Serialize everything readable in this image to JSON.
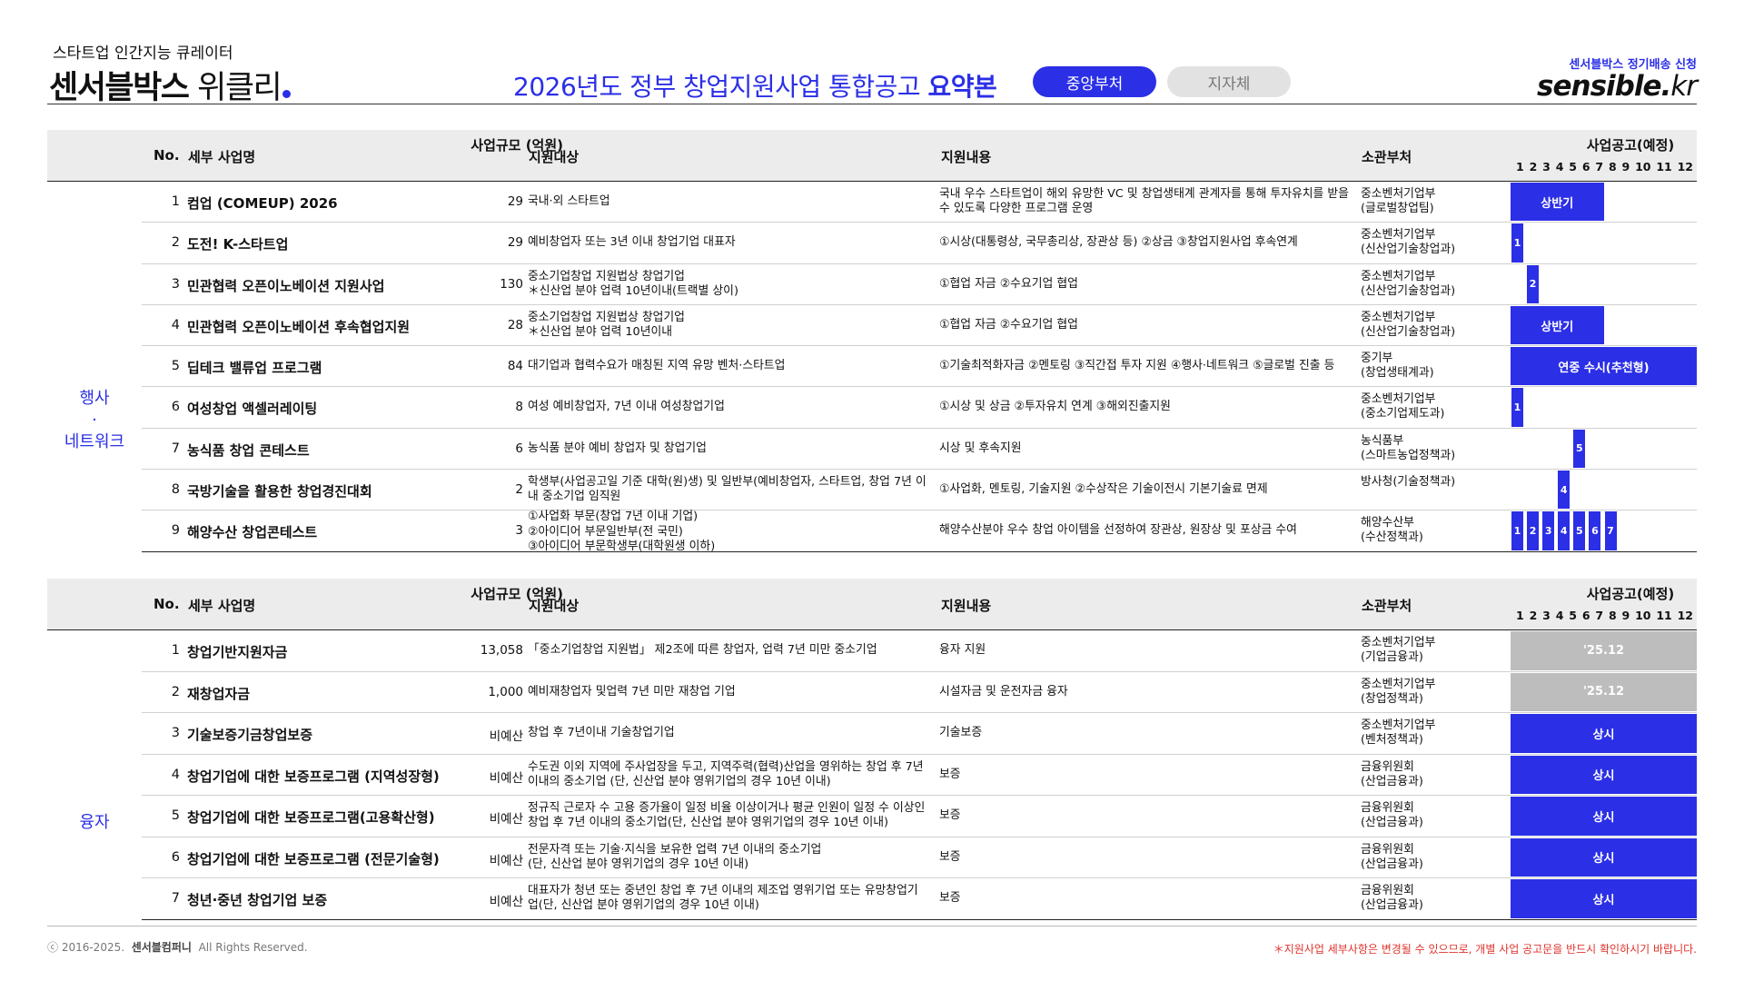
{
  "header": {
    "tagline": "스타트업 인간지능 큐레이터",
    "brand_bold": "센서블박스",
    "brand_thin": " 위클리",
    "title_main": "2026년도 정부 창업지원사업 통합공고 ",
    "title_bold": "요약본",
    "tab_active": "중앙부처",
    "tab_inactive": "지자체",
    "subscribe": "센서블박스 정기배송 신청",
    "logo_main": "sensible.",
    "logo_kr": "kr"
  },
  "table_headers": {
    "no": "No.",
    "name": "세부 사업명",
    "scale": "사업규모 (억원)",
    "target": "지원대상",
    "content": "지원내용",
    "dept": "소관부처",
    "schedule": "사업공고(예정)",
    "months": [
      "1",
      "2",
      "3",
      "4",
      "5",
      "6",
      "7",
      "8",
      "9",
      "10",
      "11",
      "12"
    ]
  },
  "section1": {
    "category": "행사 · 네트워크",
    "rows": [
      {
        "no": "1",
        "name": "컴업 (COMEUP) 2026",
        "scale": "29",
        "target": "국내·외 스타트업",
        "content": "국내 우수 스타트업이 해외 유망한 VC 및 창업생태계 관계자를 통해 투자유치를 받을\n수 있도록 다양한 프로그램 운영",
        "dept": "중소벤처기업부\n(글로벌창업팀)",
        "schedule_label": "상반기"
      },
      {
        "no": "2",
        "name": "도전! K-스타트업",
        "scale": "29",
        "target": "예비창업자 또는 3년 이내 창업기업 대표자",
        "content": "①시상(대통령상, 국무총리상, 장관상 등) ②상금 ③창업지원사업 후속연계",
        "dept": "중소벤처기업부\n(신산업기술창업과)",
        "schedule_label": "1"
      },
      {
        "no": "3",
        "name": "민관협력 오픈이노베이션 지원사업",
        "scale": "130",
        "target": "중소기업창업 지원법상 창업기업\n＊신산업 분야 업력 10년이내(트랙별 상이)",
        "content": "①협업 자금 ②수요기업 협업",
        "dept": "중소벤처기업부\n(신산업기술창업과)",
        "schedule_label": "2"
      },
      {
        "no": "4",
        "name": "민관협력 오픈이노베이션 후속협업지원",
        "scale": "28",
        "target": "중소기업창업 지원법상 창업기업\n＊신산업 분야 업력 10년이내",
        "content": "①협업 자금 ②수요기업 협업",
        "dept": "중소벤처기업부\n(신산업기술창업과)",
        "schedule_label": "상반기"
      },
      {
        "no": "5",
        "name": "딥테크 밸류업 프로그램",
        "scale": "84",
        "target": "대기업과 협력수요가 매칭된 지역 유망 벤처·스타트업",
        "content": "①기술최적화자금 ②멘토링 ③직간접 투자 지원 ④행사·네트워크 ⑤글로벌 진출 등",
        "dept": "중기부\n(창업생태계과)",
        "schedule_label": "연중 수시(추천형)"
      },
      {
        "no": "6",
        "name": "여성창업 액셀러레이팅",
        "scale": "8",
        "target": "여성 예비창업자, 7년 이내 여성창업기업",
        "content": "①시상 및 상금 ②투자유치 연계 ③해외진출지원",
        "dept": "중소벤처기업부\n(중소기업제도과)",
        "schedule_label": "1"
      },
      {
        "no": "7",
        "name": "농식품 창업 콘테스트",
        "scale": "6",
        "target": "농식품 분야 예비 창업자 및 창업기업",
        "content": "시상 및 후속지원",
        "dept": "농식품부\n(스마트농업정책과)",
        "schedule_label": "5"
      },
      {
        "no": "8",
        "name": "국방기술을 활용한 창업경진대회",
        "scale": "2",
        "target": "학생부(사업공고일 기준 대학(원)생) 및 일반부(예비창업자, 스타트업, 창업 7년 이\n내 중소기업 임직원",
        "content": "①사업화, 멘토링, 기술지원 ②수상작은 기술이전시 기본기술료 면제",
        "dept": "방사청(기술정책과)",
        "schedule_label": "4"
      },
      {
        "no": "9",
        "name": "해양수산 창업콘테스트",
        "scale": "3",
        "target": "①사업화 부문(창업 7년 이내 기업)\n②아이디어 부문일반부(전 국민)\n③아이디어 부문학생부(대학원생 이하)",
        "content": "해양수산분야 우수 창업 아이템을 선정하여 장관상, 원장상 및 포상금 수여",
        "dept": "해양수산부\n(수산정책과)",
        "schedule_labels": [
          "1",
          "2",
          "3",
          "4",
          "5",
          "6",
          "7"
        ]
      }
    ]
  },
  "section2": {
    "category": "융자",
    "rows": [
      {
        "no": "1",
        "name": "창업기반지원자금",
        "scale": "13,058",
        "target": "「중소기업창업 지원법」 제2조에 따른 창업자, 업력 7년 미만 중소기업",
        "content": "융자 지원",
        "dept": "중소벤처기업부\n(기업금융과)",
        "schedule_label": "'25.12"
      },
      {
        "no": "2",
        "name": "재창업자금",
        "scale": "1,000",
        "target": "예비재창업자 및업력 7년 미만 재창업 기업",
        "content": "시설자금 및 운전자금 융자",
        "dept": "중소벤처기업부\n(창업정책과)",
        "schedule_label": "'25.12"
      },
      {
        "no": "3",
        "name": "기술보증기금창업보증",
        "scale": "비예산",
        "target": "창업 후 7년이내 기술창업기업",
        "content": "기술보증",
        "dept": "중소벤처기업부\n(벤처정책과)",
        "schedule_label": "상시"
      },
      {
        "no": "4",
        "name": "창업기업에 대한 보증프로그램 (지역성장형)",
        "scale": "비예산",
        "target": "수도권 이외 지역에 주사업장을 두고, 지역주력(협력)산업을 영위하는 창업 후 7년\n이내의 중소기업 (단, 신산업 분야 영위기업의 경우 10년 이내)",
        "content": "보증",
        "dept": "금융위원회\n(산업금융과)",
        "schedule_label": "상시"
      },
      {
        "no": "5",
        "name": "창업기업에 대한 보증프로그램(고용확산형)",
        "scale": "비예산",
        "target": "정규직 근로자 수 고용 증가율이 일정 비율 이상이거나 평균 인원이 일정 수 이상인\n창업 후 7년 이내의 중소기업(단, 신산업 분야 영위기업의 경우 10년 이내)",
        "content": "보증",
        "dept": "금융위원회\n(산업금융과)",
        "schedule_label": "상시"
      },
      {
        "no": "6",
        "name": "창업기업에 대한 보증프로그램 (전문기술형)",
        "scale": "비예산",
        "target": "전문자격 또는 기술·지식을 보유한 업력 7년 이내의 중소기업\n(단, 신산업 분야 영위기업의 경우 10년 이내)",
        "content": "보증",
        "dept": "금융위원회\n(산업금융과)",
        "schedule_label": "상시"
      },
      {
        "no": "7",
        "name": "청년·중년 창업기업 보증",
        "scale": "비예산",
        "target": "대표자가 청년 또는 중년인 창업 후 7년 이내의 제조업 영위기업 또는 유망창업기\n업(단, 신산업 분야 영위기업의 경우 10년 이내)",
        "content": "보증",
        "dept": "금융위원회\n(산업금융과)",
        "schedule_label": "상시"
      }
    ]
  },
  "footer": {
    "copyright": "ⓒ 2016-2025.",
    "company": "센서블컴퍼니",
    "rights": "All Rights Reserved.",
    "notice": "＊지원사업 세부사항은 변경될 수 있으므로, 개별 사업 공고문을 반드시 확인하시기 바랍니다."
  },
  "colors": {
    "accent": "#2b2fe6",
    "gray_bar": "#bdbdbd",
    "header_bg": "#ececec",
    "notice": "#e0332c"
  }
}
